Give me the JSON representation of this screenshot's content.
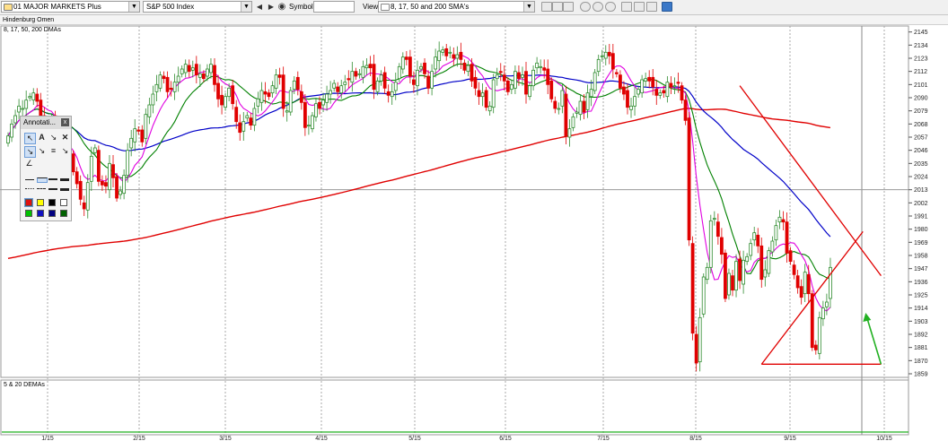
{
  "toolbar": {
    "market_list": "01 MAJOR MARKETS Plus",
    "index": "S&P 500 Index",
    "symbol_label": "Symbol",
    "symbol_value": "",
    "view_label": "View:",
    "view_value": "8, 17, 50 and 200 SMA's"
  },
  "panels": {
    "indicator_title": "Hindenburg Omen",
    "price_title": "8, 17, 50, 200 DMAs",
    "lower_title": "5 & 20 DEMAs"
  },
  "annotation_palette": {
    "title": "Annotati...",
    "close": "x",
    "colors": [
      "#e01010",
      "#ffff00",
      "#000000",
      "#ffffff",
      "#00c000",
      "#1010c0",
      "#000080",
      "#006000"
    ]
  },
  "colors": {
    "up": "#2e8b2e",
    "down": "#e00000",
    "sma8": "#e000e0",
    "sma17": "#008000",
    "sma50": "#0000c8",
    "sma200": "#e00000",
    "trendline": "#e00000",
    "arrow": "#22b022"
  },
  "chart_data": {
    "type": "candlestick",
    "title": "8, 17, 50, 200 DMAs",
    "ylim": [
      1856,
      2150
    ],
    "y_ticks": [
      2145,
      2134,
      2123,
      2112,
      2101,
      2090,
      2079,
      2068,
      2057,
      2046,
      2035,
      2024,
      2013,
      2002,
      1991,
      1980,
      1969,
      1958,
      1947,
      1936,
      1925,
      1914,
      1903,
      1892,
      1881,
      1870,
      1859
    ],
    "x_ticks": [
      "1/15",
      "2/15",
      "3/15",
      "4/15",
      "5/15",
      "6/15",
      "7/15",
      "8/15",
      "9/15",
      "10/15"
    ],
    "reference_level": 2013,
    "closes": [
      2058,
      2068,
      2075,
      2083,
      2081,
      2088,
      2091,
      2094,
      2087,
      2072,
      2060,
      2064,
      2073,
      2055,
      2040,
      2031,
      2030,
      2045,
      2028,
      2018,
      2005,
      1997,
      2019,
      2041,
      2048,
      2020,
      2017,
      2016,
      2035,
      2023,
      2006,
      2012,
      2025,
      2046,
      2056,
      2064,
      2062,
      2053,
      2076,
      2084,
      2093,
      2101,
      2109,
      2106,
      2095,
      2097,
      2103,
      2108,
      2114,
      2118,
      2112,
      2115,
      2109,
      2110,
      2106,
      2114,
      2118,
      2101,
      2089,
      2084,
      2091,
      2098,
      2085,
      2070,
      2061,
      2070,
      2075,
      2067,
      2081,
      2089,
      2096,
      2093,
      2091,
      2100,
      2109,
      2107,
      2081,
      2079,
      2096,
      2104,
      2097,
      2086,
      2065,
      2067,
      2075,
      2085,
      2081,
      2088,
      2093,
      2096,
      2102,
      2095,
      2100,
      2103,
      2105,
      2112,
      2108,
      2110,
      2116,
      2117,
      2115,
      2097,
      2104,
      2109,
      2098,
      2092,
      2095,
      2103,
      2116,
      2124,
      2122,
      2108,
      2101,
      2113,
      2116,
      2110,
      2098,
      2112,
      2124,
      2129,
      2130,
      2125,
      2128,
      2123,
      2126,
      2122,
      2113,
      2117,
      2104,
      2098,
      2091,
      2094,
      2082,
      2083,
      2105,
      2109,
      2111,
      2104,
      2095,
      2101,
      2112,
      2106,
      2109,
      2093,
      2100,
      2113,
      2119,
      2116,
      2113,
      2101,
      2089,
      2081,
      2081,
      2096,
      2058,
      2064,
      2074,
      2078,
      2087,
      2078,
      2094,
      2097,
      2111,
      2122,
      2125,
      2128,
      2125,
      2114,
      2110,
      2098,
      2093,
      2082,
      2083,
      2091,
      2097,
      2105,
      2106,
      2104,
      2099,
      2092,
      2094,
      2094,
      2103,
      2099,
      2100,
      2102,
      2088,
      2071,
      1971,
      1893,
      1868,
      1906,
      1940,
      1948,
      1987,
      1989,
      1974,
      1959,
      1922,
      1943,
      1929,
      1953,
      1937,
      1954,
      1957,
      1968,
      1977,
      1966,
      1938,
      1946,
      1962,
      1970,
      1983,
      1990,
      1986,
      1960,
      1953,
      1942,
      1931,
      1923,
      1944,
      1926,
      1881,
      1879,
      1906,
      1914,
      1919,
      1948
    ]
  }
}
